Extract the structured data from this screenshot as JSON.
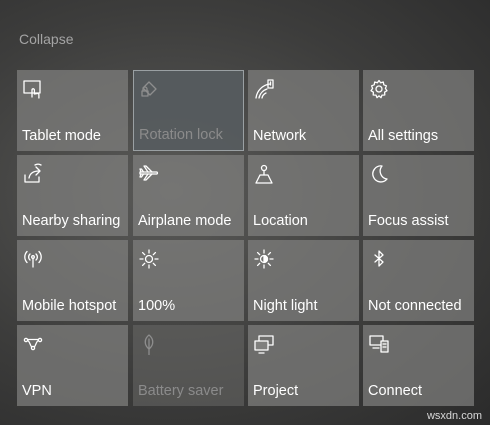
{
  "collapse_label": "Collapse",
  "tiles": [
    {
      "label": "Tablet mode",
      "icon": "tablet-mode-icon",
      "state": "normal"
    },
    {
      "label": "Rotation lock",
      "icon": "rotation-lock-icon",
      "state": "hover-disabled"
    },
    {
      "label": "Network",
      "icon": "network-icon",
      "state": "normal"
    },
    {
      "label": "All settings",
      "icon": "gear-icon",
      "state": "normal"
    },
    {
      "label": "Nearby sharing",
      "icon": "nearby-sharing-icon",
      "state": "normal"
    },
    {
      "label": "Airplane mode",
      "icon": "airplane-icon",
      "state": "normal"
    },
    {
      "label": "Location",
      "icon": "location-icon",
      "state": "normal"
    },
    {
      "label": "Focus assist",
      "icon": "moon-icon",
      "state": "normal"
    },
    {
      "label": "Mobile hotspot",
      "icon": "hotspot-icon",
      "state": "normal"
    },
    {
      "label": "100%",
      "icon": "brightness-icon",
      "state": "normal"
    },
    {
      "label": "Night light",
      "icon": "night-light-icon",
      "state": "normal"
    },
    {
      "label": "Not connected",
      "icon": "bluetooth-icon",
      "state": "normal"
    },
    {
      "label": "VPN",
      "icon": "vpn-icon",
      "state": "normal"
    },
    {
      "label": "Battery saver",
      "icon": "battery-saver-icon",
      "state": "disabled"
    },
    {
      "label": "Project",
      "icon": "project-icon",
      "state": "normal"
    },
    {
      "label": "Connect",
      "icon": "connect-icon",
      "state": "normal"
    }
  ],
  "watermark": "wsxdn.com"
}
